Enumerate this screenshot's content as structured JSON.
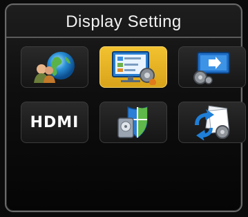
{
  "title": "Display Setting",
  "accent_color": "#e3b12a",
  "tiles": [
    {
      "icon": "globe-users-icon",
      "selected": false
    },
    {
      "icon": "display-settings-icon",
      "selected": true
    },
    {
      "icon": "video-output-icon",
      "selected": false
    },
    {
      "icon": "hdmi-icon",
      "label": "HDMI",
      "selected": false
    },
    {
      "icon": "shield-disk-icon",
      "selected": false
    },
    {
      "icon": "refresh-gears-icon",
      "selected": false
    }
  ]
}
